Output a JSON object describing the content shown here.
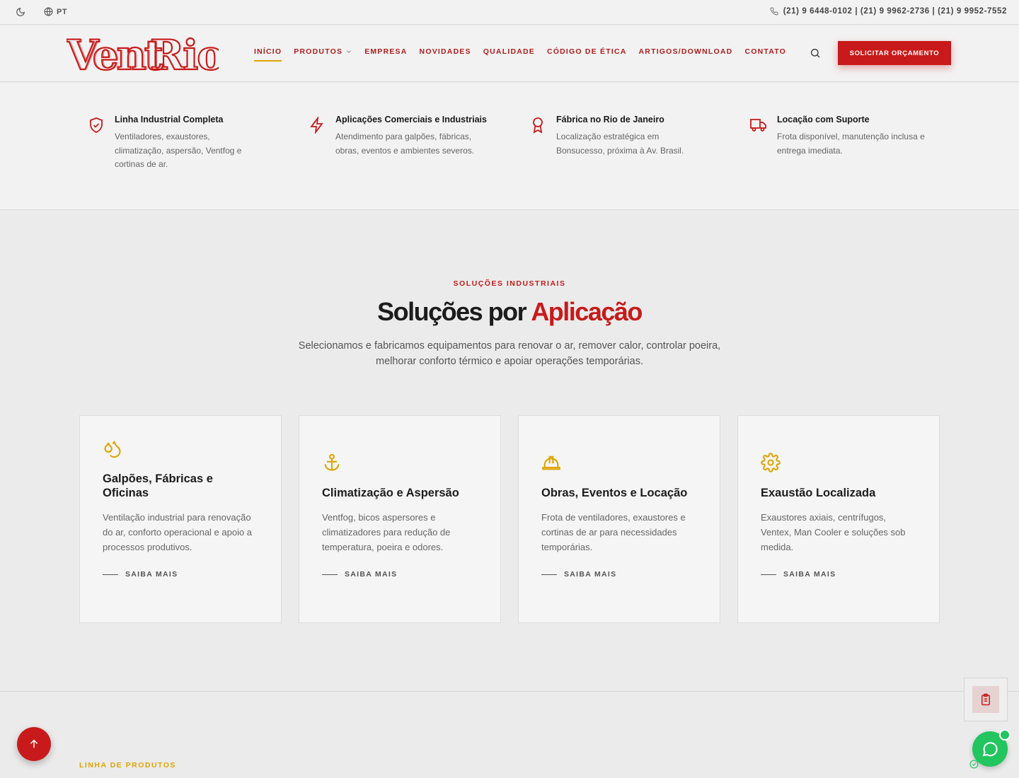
{
  "topbar": {
    "language": "PT",
    "phones": "(21) 9 6448-0102 | (21) 9 9962-2736 | (21) 9 9952-7552"
  },
  "header": {
    "logo_text": "Vent Rio",
    "nav": [
      {
        "label": "INÍCIO"
      },
      {
        "label": "PRODUTOS"
      },
      {
        "label": "EMPRESA"
      },
      {
        "label": "NOVIDADES"
      },
      {
        "label": "QUALIDADE"
      },
      {
        "label": "CÓDIGO DE ÉTICA"
      },
      {
        "label": "ARTIGOS/DOWNLOAD"
      },
      {
        "label": "CONTATO"
      }
    ],
    "cta_label": "SOLICITAR ORÇAMENTO"
  },
  "features": [
    {
      "icon": "shield-check-icon",
      "title": "Linha Industrial Completa",
      "text": "Ventiladores, exaustores, climatização, aspersão, Ventfog e cortinas de ar."
    },
    {
      "icon": "lightning-icon",
      "title": "Aplicações Comerciais e Industriais",
      "text": "Atendimento para galpões, fábricas, obras, eventos e ambientes severos."
    },
    {
      "icon": "award-icon",
      "title": "Fábrica no Rio de Janeiro",
      "text": "Localização estratégica em Bonsucesso, próxima à Av. Brasil."
    },
    {
      "icon": "truck-icon",
      "title": "Locação com Suporte",
      "text": "Frota disponível, manutenção inclusa e entrega imediata."
    }
  ],
  "solutions": {
    "eyebrow": "SOLUÇÕES INDUSTRIAIS",
    "title_main": "Soluções por",
    "title_accent": "Aplicação",
    "subtitle": "Selecionamos e fabricamos equipamentos para renovar o ar, remover calor, controlar poeira, melhorar conforto térmico e apoiar operações temporárias.",
    "cards": [
      {
        "icon": "droplets-icon",
        "title": "Galpões, Fábricas e Oficinas",
        "text": "Ventilação industrial para renovação do ar, conforto operacional e apoio a processos produtivos.",
        "link": "SAIBA MAIS"
      },
      {
        "icon": "anchor-icon",
        "title": "Climatização e Aspersão",
        "text": "Ventfog, bicos aspersores e climatizadores para redução de temperatura, poeira e odores.",
        "link": "SAIBA MAIS"
      },
      {
        "icon": "hard-hat-icon",
        "title": "Obras, Eventos e Locação",
        "text": "Frota de ventiladores, exaustores e cortinas de ar para necessidades temporárias.",
        "link": "SAIBA MAIS"
      },
      {
        "icon": "gear-icon",
        "title": "Exaustão Localizada",
        "text": "Exaustores axiais, centrífugos, Ventex, Man Cooler e soluções sob medida.",
        "link": "SAIBA MAIS"
      }
    ]
  },
  "products": {
    "eyebrow": "LINHA DE PRODUTOS"
  },
  "colors": {
    "brand_red": "#c81a1a",
    "accent_gold": "#e0a400",
    "whatsapp_green": "#22c55e"
  }
}
